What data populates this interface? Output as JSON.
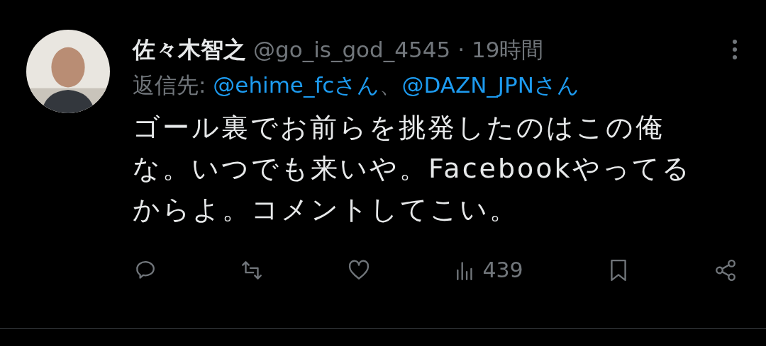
{
  "author": {
    "name": "佐々木智之",
    "handle": "@go_is_god_4545",
    "separator": "·",
    "time": "19時間"
  },
  "reply_to": {
    "label": "返信先:",
    "mentions": [
      "@ehime_fcさん",
      "@DAZN_JPNさん"
    ],
    "joiner": "、"
  },
  "text_lines": [
    "ゴール裏でお前らを挑発したのはこの俺",
    "な。いつでも来いや。Facebookやってる",
    "からよ。コメントしてこい。"
  ],
  "actions": [
    {
      "kind": "reply"
    },
    {
      "kind": "retweet"
    },
    {
      "kind": "like"
    },
    {
      "kind": "views",
      "count": "439"
    },
    {
      "kind": "bookmark"
    },
    {
      "kind": "share"
    }
  ]
}
